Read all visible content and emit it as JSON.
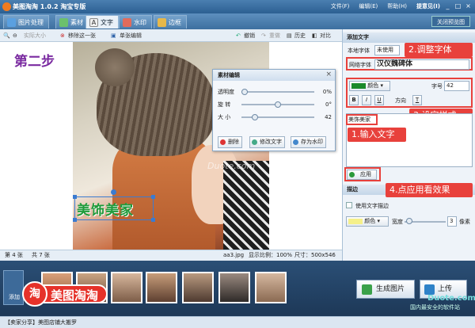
{
  "window": {
    "title": "美图淘淘 1.0.2 淘宝专版",
    "controls": [
      "_",
      "□",
      "×"
    ]
  },
  "menu": [
    "文件(F)",
    "编辑(E)",
    "帮助(H)",
    "提意见(I)"
  ],
  "tabs": [
    {
      "label": "图片处理",
      "active": false
    },
    {
      "label": "素材",
      "active": false
    },
    {
      "label": "文字",
      "active": true
    },
    {
      "label": "水印",
      "active": false
    },
    {
      "label": "边框",
      "active": false
    }
  ],
  "close_preview": "关闭预览图",
  "toolbar": {
    "actual_size": "实际大小",
    "remove": "移除这一张",
    "single_edit": "单张编辑",
    "undo": "撤销",
    "redo": "重做",
    "history": "历史",
    "compare": "对比"
  },
  "canvas": {
    "step_label": "第二步",
    "text_overlay": "美饰美家",
    "watermark": "Duote.com"
  },
  "dialog": {
    "title": "素材编辑",
    "close": "×",
    "sliders": [
      {
        "label": "透明度",
        "value": "0%",
        "level": 0.0
      },
      {
        "label": "旋  转",
        "value": "0°",
        "level": 0.5
      },
      {
        "label": "大  小",
        "value": "42",
        "level": 0.15
      }
    ],
    "buttons": [
      "删除",
      "修改文字",
      "存为水印"
    ]
  },
  "status": {
    "index": "第 4 张",
    "total": "共 7 张",
    "filename": "aa3.jpg",
    "zoom": "显示比例：100%",
    "size": "尺寸：500x546"
  },
  "panel": {
    "title": "添加文字",
    "local_font_label": "本地字体",
    "local_font_value": "未使用",
    "web_font_label": "网络字体",
    "web_font_value": "汉仪魏碑体",
    "callout_font": "2.调整字体",
    "color_label": "颜色",
    "color_swatch": "#1a8a2a",
    "size_label": "字号",
    "size_value": "42",
    "style_buttons": [
      "B",
      "I",
      "U"
    ],
    "direction": "方向",
    "callout_style": "3.设定样式",
    "text_value": "美饰美家",
    "callout_input": "1.输入文字",
    "apply": "应用",
    "callout_apply": "4.点应用看效果",
    "stroke_title": "描边",
    "use_stroke": "使用文字描边",
    "stroke_color_label": "颜色",
    "stroke_color_swatch": "#f5f08a",
    "width_label": "宽度",
    "width_value": "3",
    "width_unit": "像素"
  },
  "film": {
    "add": "添加",
    "brand": "美图淘淘",
    "brand_char": "淘",
    "generate": "生成图片",
    "upload": "上传",
    "site": "国内最安全的软件站",
    "watermark2": "Duote.com"
  },
  "bottom": {
    "text": "【卖家分享】美图店铺大搬罗"
  }
}
